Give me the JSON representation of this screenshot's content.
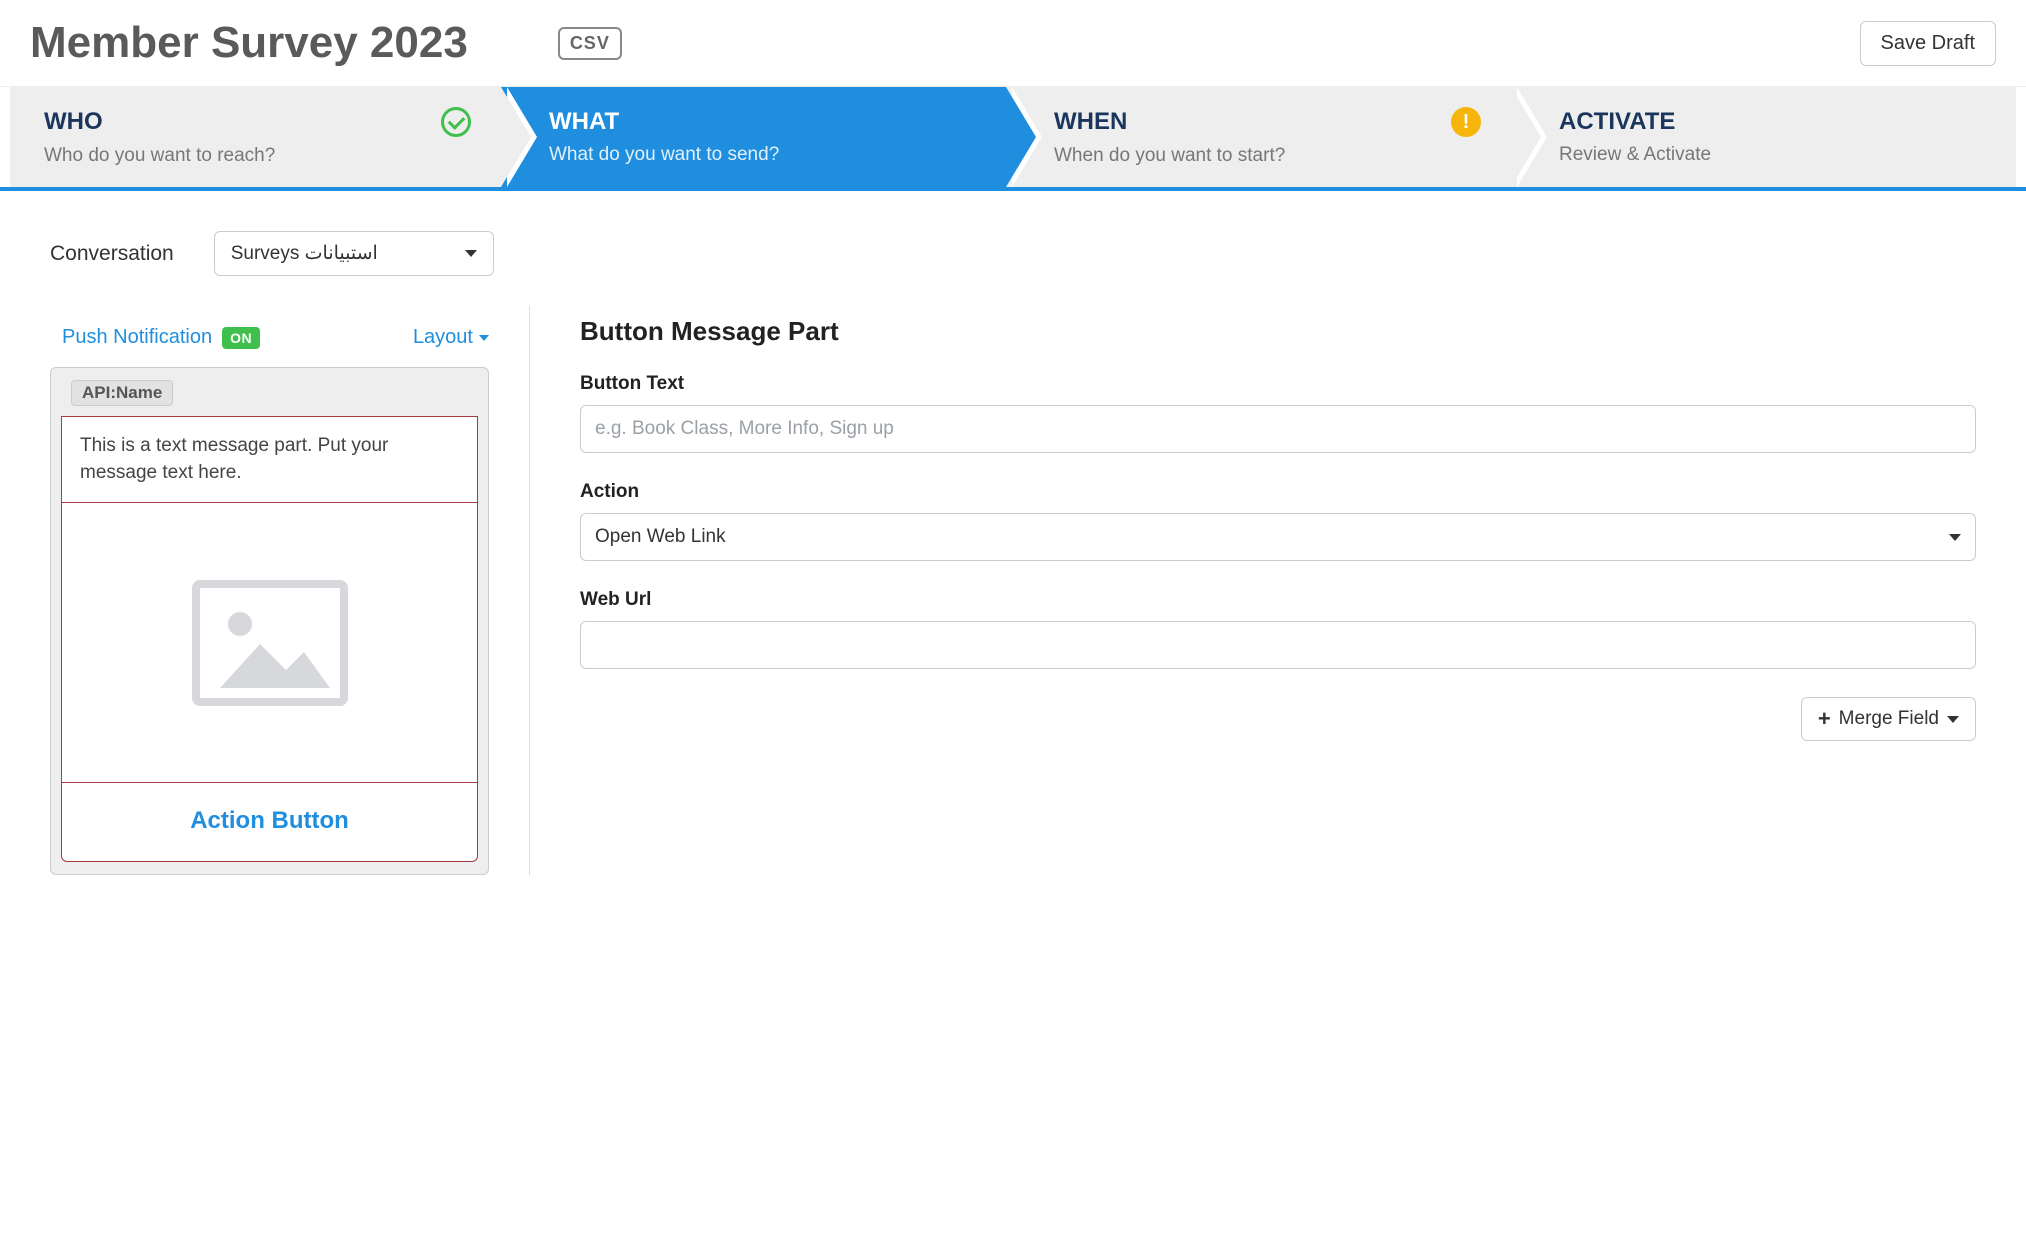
{
  "header": {
    "title": "Member Survey 2023",
    "csv_label": "CSV",
    "save_draft_label": "Save Draft"
  },
  "steps": [
    {
      "title": "WHO",
      "subtitle": "Who do you want to reach?",
      "status": "complete"
    },
    {
      "title": "WHAT",
      "subtitle": "What do you want to send?",
      "status": "active"
    },
    {
      "title": "WHEN",
      "subtitle": "When do you want to start?",
      "status": "warning"
    },
    {
      "title": "ACTIVATE",
      "subtitle": "Review & Activate",
      "status": "pending"
    }
  ],
  "conversation": {
    "label": "Conversation",
    "selected": "Surveys استبيانات"
  },
  "preview": {
    "push_notification_label": "Push Notification",
    "push_badge": "ON",
    "layout_label": "Layout",
    "api_badge": "API:Name",
    "text_part": "This is a text message part. Put your message text here.",
    "action_button_label": "Action Button"
  },
  "right": {
    "panel_title": "Button Message Part",
    "button_text_label": "Button Text",
    "button_text_placeholder": "e.g. Book Class, More Info, Sign up",
    "button_text_value": "",
    "action_label": "Action",
    "action_selected": "Open Web Link",
    "web_url_label": "Web Url",
    "web_url_value": "",
    "merge_field_label": "Merge Field"
  }
}
